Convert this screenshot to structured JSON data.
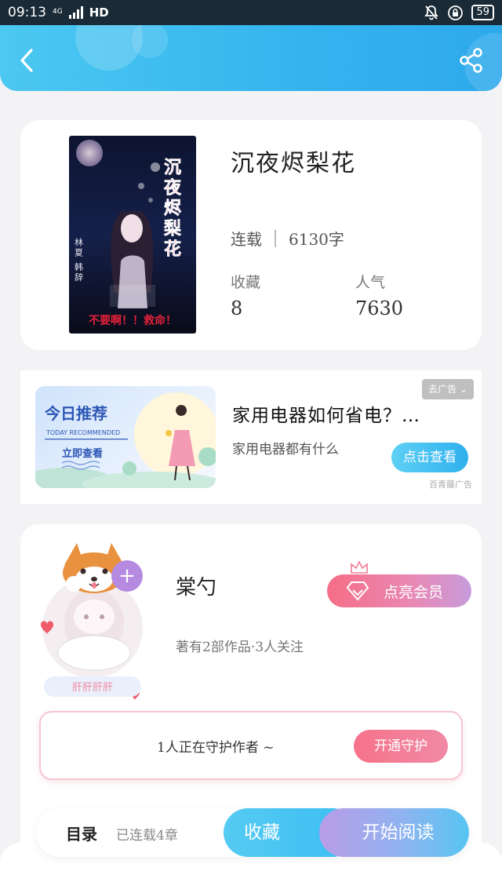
{
  "status_bar": {
    "time": "09:13",
    "network_type": "4G",
    "hd": "HD",
    "battery": "59",
    "icons": [
      "signal-icon",
      "mute-bell-icon",
      "lock-rotation-icon",
      "battery-icon"
    ]
  },
  "header": {
    "icons": [
      "back-arrow-icon",
      "share-icon"
    ],
    "accent_color": "#33b4ee"
  },
  "book": {
    "title": "沉夜烬梨花",
    "status": "连载",
    "word_count": "6130字",
    "favorites_label": "收藏",
    "favorites_value": "8",
    "popularity_label": "人气",
    "popularity_value": "7630",
    "cover": {
      "title_text": "沉夜烬梨花",
      "authors": "林夏 韩辞",
      "tagline": "不要啊！！救命！"
    }
  },
  "ad": {
    "banner_title": "今日推荐",
    "banner_subtitle": "TODAY RECOMMENDED",
    "banner_cta": "立即查看",
    "headline": "家用电器如何省电？…",
    "description": "家用电器都有什么",
    "close_label": "去广告",
    "cta_label": "点击查看",
    "source_label": "百青藤广告"
  },
  "author": {
    "name": "棠勺",
    "info": "著有2部作品·3人关注",
    "badge_text": "肝肝肝肝",
    "vip_label": "点亮会员",
    "guard_text": "1人正在守护作者 ~",
    "guard_button": "开通守护",
    "vip_color": "#f66d86"
  },
  "bottom_bar": {
    "toc_label": "目录",
    "chapter_count": "已连载4章",
    "favorite_button": "收藏",
    "read_button": "开始阅读"
  }
}
